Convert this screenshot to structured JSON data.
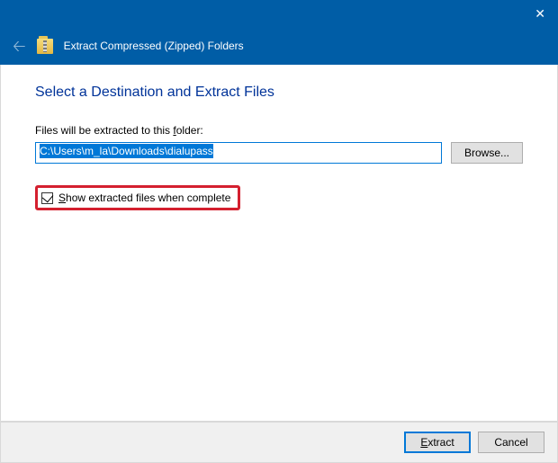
{
  "window": {
    "title": "Extract Compressed (Zipped) Folders"
  },
  "heading": "Select a Destination and Extract Files",
  "destination": {
    "label_pre": "Files will be extracted to this ",
    "label_accel": "f",
    "label_post": "older:",
    "path": "C:\\Users\\m_la\\Downloads\\dialupass",
    "browse": "Browse..."
  },
  "checkbox": {
    "label_accel": "S",
    "label_rest": "how extracted files when complete",
    "checked": true
  },
  "buttons": {
    "extract_accel": "E",
    "extract_rest": "xtract",
    "cancel": "Cancel"
  }
}
